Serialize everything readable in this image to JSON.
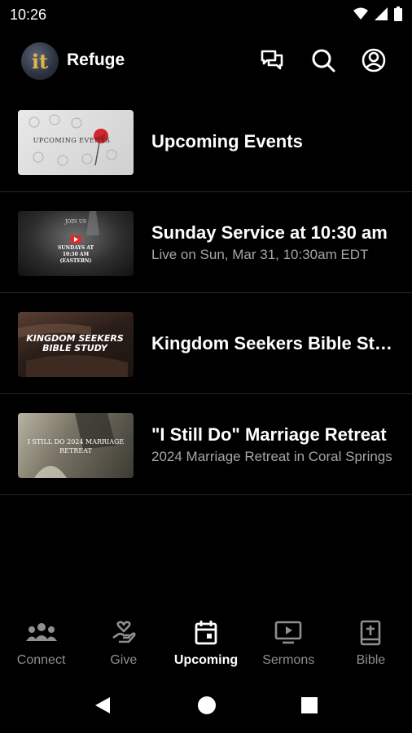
{
  "status_bar": {
    "time": "10:26"
  },
  "header": {
    "app_name": "Refuge",
    "logo_glyph": "it"
  },
  "events": [
    {
      "title": "Upcoming Events",
      "subtitle": "",
      "thumb_caption": "UPCOMING EVENTS"
    },
    {
      "title": "Sunday Service at 10:30 am",
      "subtitle": "Live on Sun, Mar 31, 10:30am EDT",
      "thumb_caption_top": "JOIN US",
      "thumb_caption": "SUNDAYS AT 10:30 AM (EASTERN)"
    },
    {
      "title": "Kingdom Seekers Bible Study",
      "subtitle": "",
      "thumb_caption": "KINGDOM SEEKERS BIBLE STUDY"
    },
    {
      "title": "\"I Still Do\" Marriage Retreat",
      "subtitle": "2024 Marriage Retreat in Coral Springs",
      "thumb_caption": "I STILL DO 2024 MARRIAGE RETREAT"
    }
  ],
  "bottom_nav": [
    {
      "label": "Connect",
      "icon": "people-group-icon",
      "active": false
    },
    {
      "label": "Give",
      "icon": "hand-heart-icon",
      "active": false
    },
    {
      "label": "Upcoming",
      "icon": "calendar-icon",
      "active": true
    },
    {
      "label": "Sermons",
      "icon": "tv-play-icon",
      "active": false
    },
    {
      "label": "Bible",
      "icon": "bible-icon",
      "active": false
    }
  ],
  "colors": {
    "background": "#000000",
    "text": "#ffffff",
    "muted": "#a6a6a6",
    "nav_inactive": "#8f8f8f",
    "accent_logo": "#e0b64a"
  }
}
